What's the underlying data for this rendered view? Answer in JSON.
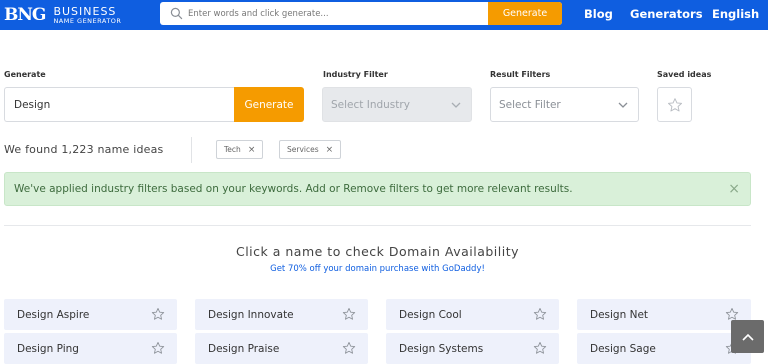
{
  "brand": {
    "mark": "BNG",
    "line1": "BUSINESS",
    "line2": "NAME GENERATOR"
  },
  "search": {
    "placeholder": "Enter words and click generate...",
    "button_label": "Generate"
  },
  "nav": {
    "blog": "Blog",
    "generators": "Generators",
    "language": "English"
  },
  "filters": {
    "generate_label": "Generate",
    "generate_value": "Design",
    "generate_button": "Generate",
    "industry_label": "Industry Filter",
    "industry_placeholder": "Select Industry",
    "result_label": "Result Filters",
    "result_placeholder": "Select Filter",
    "saved_label": "Saved ideas"
  },
  "results": {
    "found_text": "We found 1,223 name ideas",
    "chips": [
      {
        "label": "Tech"
      },
      {
        "label": "Services"
      }
    ]
  },
  "alert": {
    "message": "We've applied industry filters based on your keywords. Add or Remove filters to get more relevant results.",
    "close": "×"
  },
  "headline": "Click a name to check Domain Availability",
  "promo": "Get 70% off your domain purchase with GoDaddy!",
  "names": [
    {
      "label": "Design Aspire"
    },
    {
      "label": "Design Innovate"
    },
    {
      "label": "Design Cool"
    },
    {
      "label": "Design Net"
    },
    {
      "label": "Design Ping"
    },
    {
      "label": "Design Praise"
    },
    {
      "label": "Design Systems"
    },
    {
      "label": "Design Sage"
    }
  ],
  "colors": {
    "nav_blue": "#0f5ee0",
    "accent_orange": "#f59b00",
    "alert_green": "#d9f0d9",
    "card_bg": "#eef1fb"
  }
}
